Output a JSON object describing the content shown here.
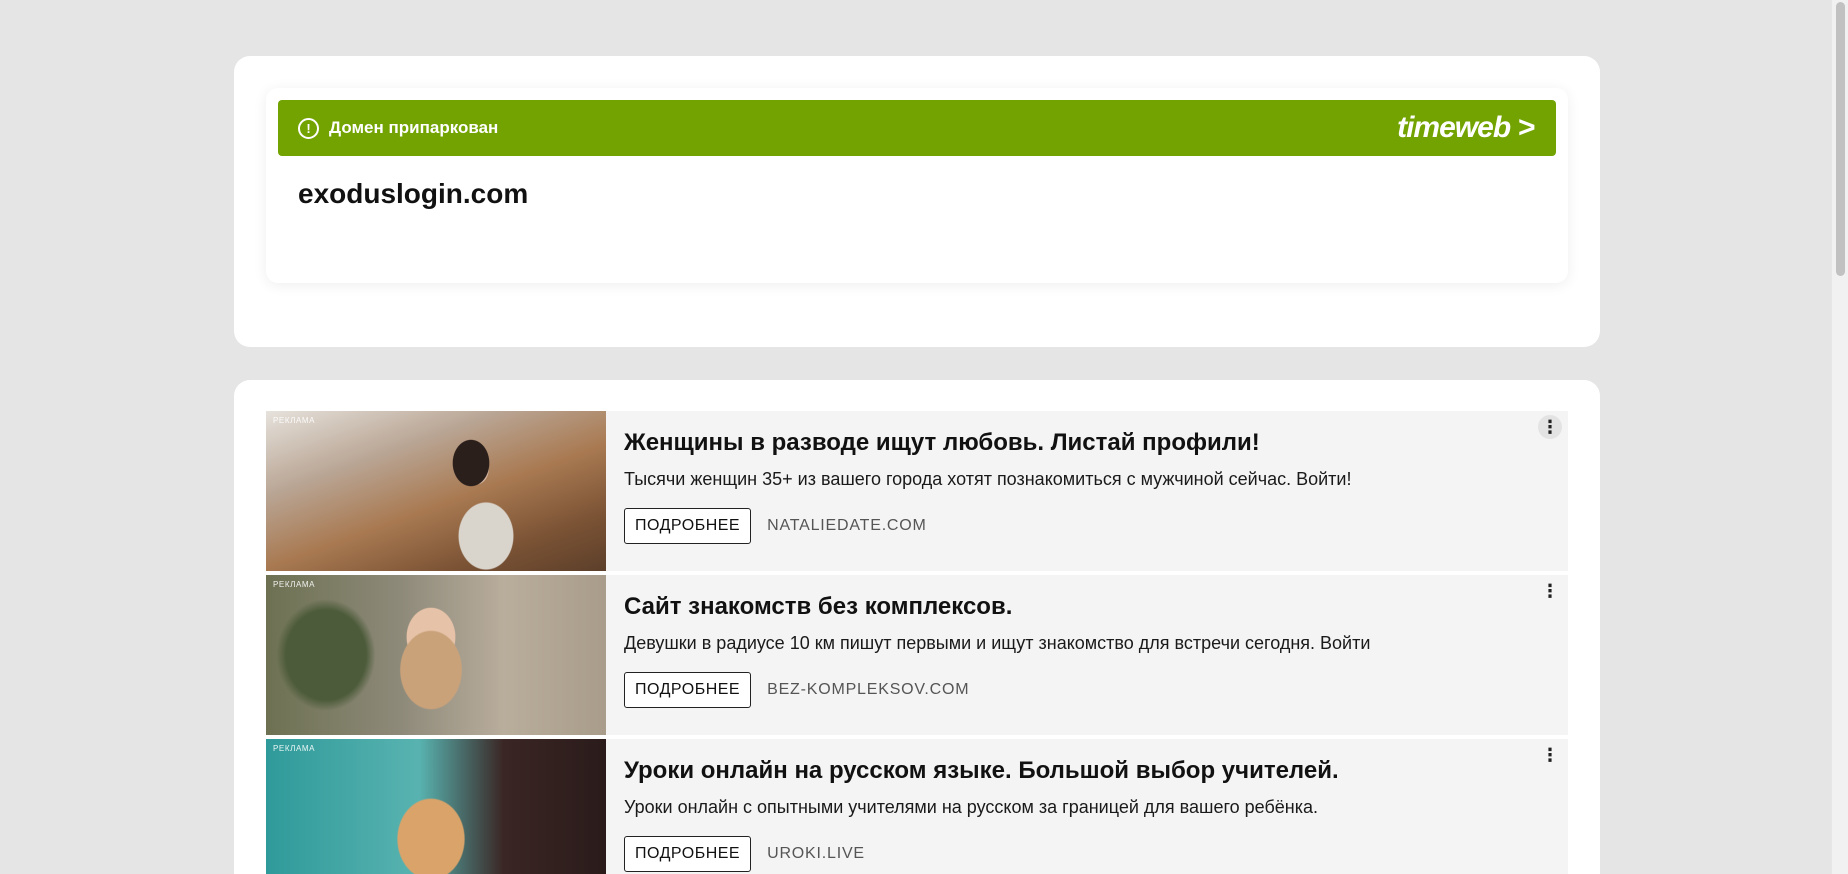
{
  "parked": {
    "banner_text": "Домен припаркован",
    "brand": "timeweb >",
    "domain": "exoduslogin.com"
  },
  "ads": [
    {
      "label": "РЕКЛАМА",
      "title": "Женщины в разводе ищут любовь. Листай профили!",
      "description": "Тысячи женщин 35+ из вашего города хотят познакомиться с мужчиной сейчас. Войти!",
      "button": "ПОДРОБНЕЕ",
      "domain": "NATALIEDATE.COM",
      "menu_icon": "⋮"
    },
    {
      "label": "РЕКЛАМА",
      "title": "Сайт знакомств без комплексов.",
      "description": "Девушки в радиусе 10 км пишут первыми и ищут знакомство для встречи сегодня. Войти",
      "button": "ПОДРОБНЕЕ",
      "domain": "BEZ-KOMPLEKSOV.COM",
      "menu_icon": "⋮"
    },
    {
      "label": "РЕКЛАМА",
      "title": "Уроки онлайн на русском языке. Большой выбор учителей.",
      "description": "Уроки онлайн с опытными учителями на русском за границей для вашего ребёнка.",
      "button": "ПОДРОБНЕЕ",
      "domain": "UROKI.LIVE",
      "menu_icon": "⋮"
    }
  ],
  "colors": {
    "banner": "#72a300",
    "page_bg": "#e5e5e5",
    "ad_bg": "#f4f4f4"
  }
}
